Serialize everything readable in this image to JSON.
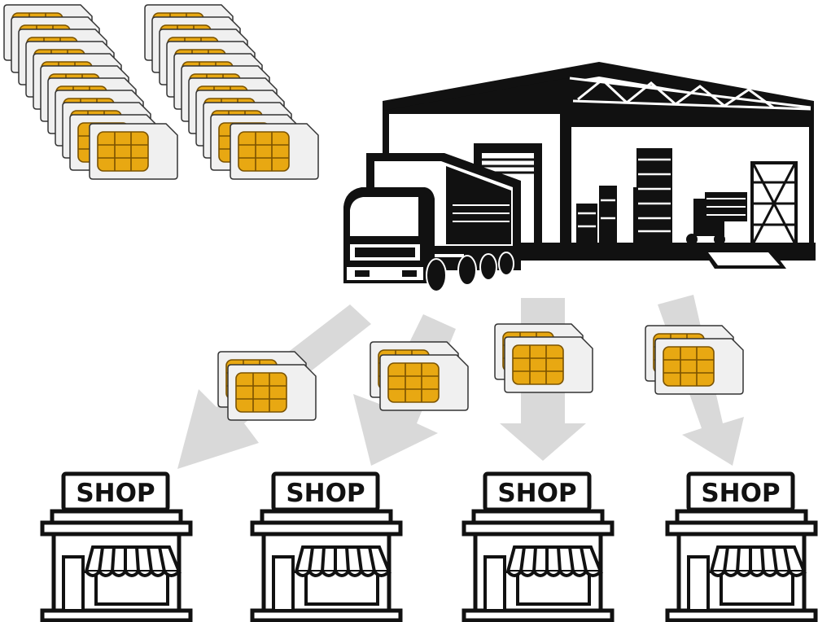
{
  "colors": {
    "ink": "#111111",
    "card": "#f0f0f0",
    "card_stroke": "#333333",
    "chip": "#e8a812",
    "chip_stroke": "#7a5200",
    "arrow": "#d9d9d9"
  },
  "icons": {
    "sim": "sim-card-icon",
    "warehouse": "warehouse-icon",
    "truck": "truck-icon",
    "shop": "shop-icon"
  },
  "shops": [
    {
      "label": "SHOP"
    },
    {
      "label": "SHOP"
    },
    {
      "label": "SHOP"
    },
    {
      "label": "SHOP"
    }
  ]
}
